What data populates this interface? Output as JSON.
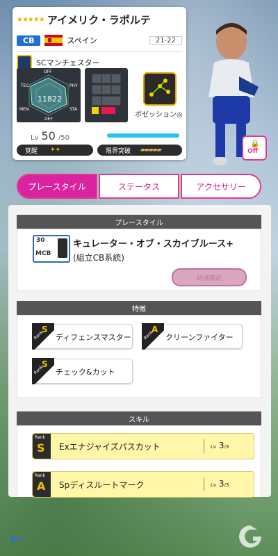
{
  "player": {
    "stars": "★★★★★",
    "name": "アイメリク・ラポルテ",
    "position": "CB",
    "nationality": "スペイン",
    "season": "21-22",
    "club": "SCマンチェスター",
    "overall": "11822",
    "stat_labels": [
      "OFF",
      "TEC",
      "PHY",
      "MEN",
      "STA",
      "DEF"
    ],
    "position_label": "ポゼッション◎",
    "lv_label": "Lv",
    "level": "50",
    "level_max": "/50",
    "awakening_label": "覚醒",
    "awakening_stars": "✦✦",
    "limit_label": "限界突破",
    "limit_bars": "▰▰▰▰▰",
    "lock_toggle": "Off"
  },
  "tabs": [
    "プレースタイル",
    "ステータス",
    "アクセサリー"
  ],
  "play_style": {
    "section_title": "プレースタイル",
    "number": "30",
    "pos": "MCB",
    "title": "キュレーター・オブ・スカイブルース+",
    "subtitle": "(組立CB系統)",
    "detail_button": "詳細確認"
  },
  "features": {
    "section_title": "特徴",
    "rank_word": "Rank",
    "items": [
      {
        "rank": "S",
        "label": "ディフェンスマスター"
      },
      {
        "rank": "A",
        "label": "クリーンファイター"
      },
      {
        "rank": "S",
        "label": "チェック&カット"
      }
    ]
  },
  "skills": {
    "section_title": "スキル",
    "rank_word": "Rank",
    "lv_word": "Lv",
    "items": [
      {
        "rank": "S",
        "label": "Exエナジャイズパスカット",
        "lv": "3",
        "max": "/3"
      },
      {
        "rank": "A",
        "label": "Spディスルートマーク",
        "lv": "3",
        "max": "/3"
      }
    ]
  },
  "nav": {
    "back_icon": "←"
  }
}
